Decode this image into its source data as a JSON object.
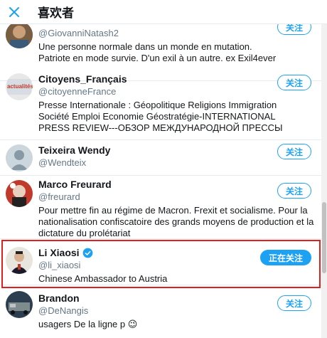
{
  "header": {
    "title": "喜欢者"
  },
  "users": [
    {
      "name": "",
      "handle": "@GiovanniNatash2",
      "bio": "Une personne normale dans un monde en mutation. Patriote en mode survie. D'un exil à un autre. ex Exil4ever",
      "button": "关注"
    },
    {
      "name": "Citoyens_Français",
      "handle": "@citoyenneFrance",
      "bio": "Presse Internationale : Géopolitique Religions Immigration Société Emploi Economie Géostratégie-INTERNATIONAL PRESS REVIEW---ОБЗОР МЕЖДУНАРОДНОЙ ПРЕССЫ",
      "button": "关注",
      "avatar_text": "actualités"
    },
    {
      "name": "Teixeira Wendy",
      "handle": "@Wendteix",
      "bio": "",
      "button": "关注"
    },
    {
      "name": "Marco Freurard",
      "handle": "@freurard",
      "bio": "Pour mettre fin au régime de Macron. Frexit et socialisme. Pour la nationalisation confiscatoire des grands moyens de production et la dictature du prolétariat",
      "button": "关注"
    },
    {
      "name": "Li Xiaosi",
      "handle": "@li_xiaosi",
      "bio": "Chinese Ambassador to Austria",
      "button": "正在关注",
      "verified": true
    },
    {
      "name": "Brandon",
      "handle": "@DeNangis",
      "bio": "usagers De la ligne p 😉",
      "button": "关注"
    }
  ],
  "colors": {
    "accent": "#1da1f2",
    "highlight": "#e0201e"
  },
  "icons": {
    "close": "close-icon",
    "verified": "verified-badge-icon"
  }
}
